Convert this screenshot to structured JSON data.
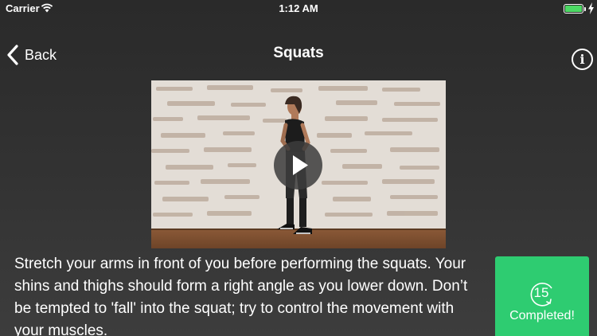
{
  "status_bar": {
    "carrier": "Carrier",
    "time": "1:12 AM",
    "battery_color": "#4cd964"
  },
  "nav": {
    "back_label": "Back",
    "title": "Squats",
    "info_icon_glyph": "i"
  },
  "video": {
    "play_icon": "play-icon"
  },
  "description": "Stretch your arms in front of you before performing the squats. Your shins and thighs should form a right angle as you lower down. Don’t be tempted to 'fall' into the squat; try to control the movement with your muscles.",
  "completed_button": {
    "counter": "15",
    "label": "Completed!",
    "color": "#2ecc71"
  }
}
